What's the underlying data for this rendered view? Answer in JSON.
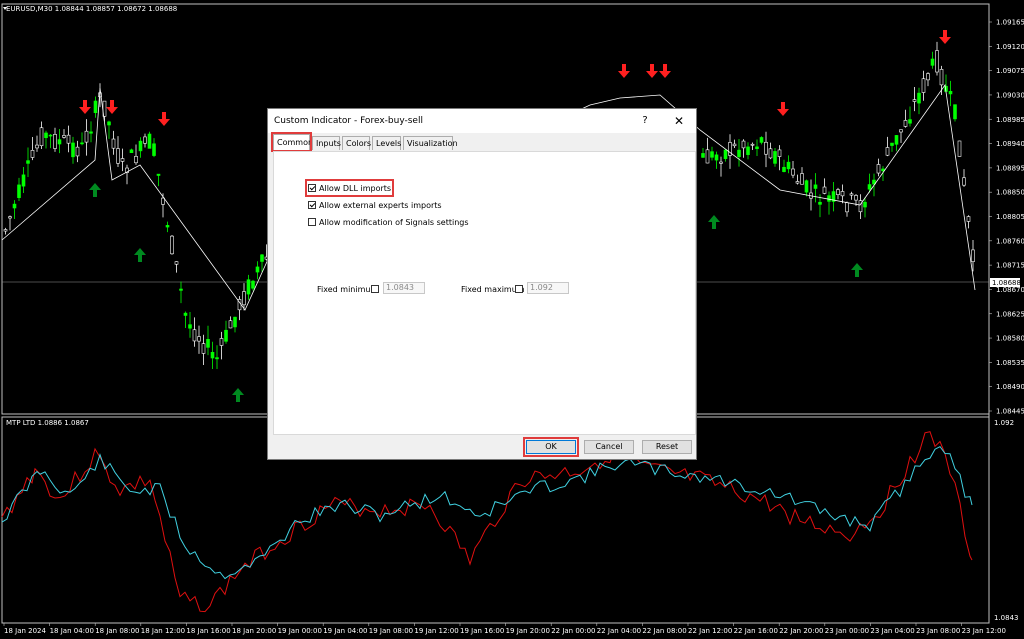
{
  "chart": {
    "symbol_info": "EURUSD,M30  1.08844 1.08857 1.08672 1.08688",
    "indicator_info": "MTP LTD 1.0886 1.0867",
    "current_price": "1.08688",
    "price_ticks": [
      "1.09165",
      "1.09120",
      "1.09075",
      "1.09030",
      "1.08985",
      "1.08940",
      "1.08895",
      "1.08850",
      "1.08805",
      "1.08760",
      "1.08715",
      "1.08670",
      "1.08625",
      "1.08580",
      "1.08535",
      "1.08490",
      "1.08445"
    ],
    "indicator_ticks": [
      "1.092",
      "1.0843"
    ],
    "time_ticks": [
      "18 Jan 2024",
      "18 Jan 04:00",
      "18 Jan 08:00",
      "18 Jan 12:00",
      "18 Jan 16:00",
      "18 Jan 20:00",
      "19 Jan 00:00",
      "19 Jan 04:00",
      "19 Jan 08:00",
      "19 Jan 12:00",
      "19 Jan 16:00",
      "19 Jan 20:00",
      "22 Jan 00:00",
      "22 Jan 04:00",
      "22 Jan 08:00",
      "22 Jan 12:00",
      "22 Jan 16:00",
      "22 Jan 20:00",
      "23 Jan 00:00",
      "23 Jan 04:00",
      "23 Jan 08:00",
      "23 Jan 12:00"
    ],
    "colors": {
      "bull": "#00ff00",
      "bear": "#ffffff",
      "signal_down": "#ff2020",
      "signal_up": "#008a20",
      "line_red": "#e01010",
      "line_cyan": "#40d0e0"
    }
  },
  "dialog": {
    "title": "Custom Indicator - Forex-buy-sell",
    "help": "?",
    "close": "✕",
    "tabs": [
      "Common",
      "Inputs",
      "Colors",
      "Levels",
      "Visualization"
    ],
    "allow_dll": "Allow DLL imports",
    "allow_experts": "Allow external experts imports",
    "allow_signals": "Allow modification of Signals settings",
    "fixed_min_label": "Fixed minimum",
    "fixed_min_value": "1.0843",
    "fixed_max_label": "Fixed maximum",
    "fixed_max_value": "1.092",
    "ok": "OK",
    "cancel": "Cancel",
    "reset": "Reset"
  }
}
